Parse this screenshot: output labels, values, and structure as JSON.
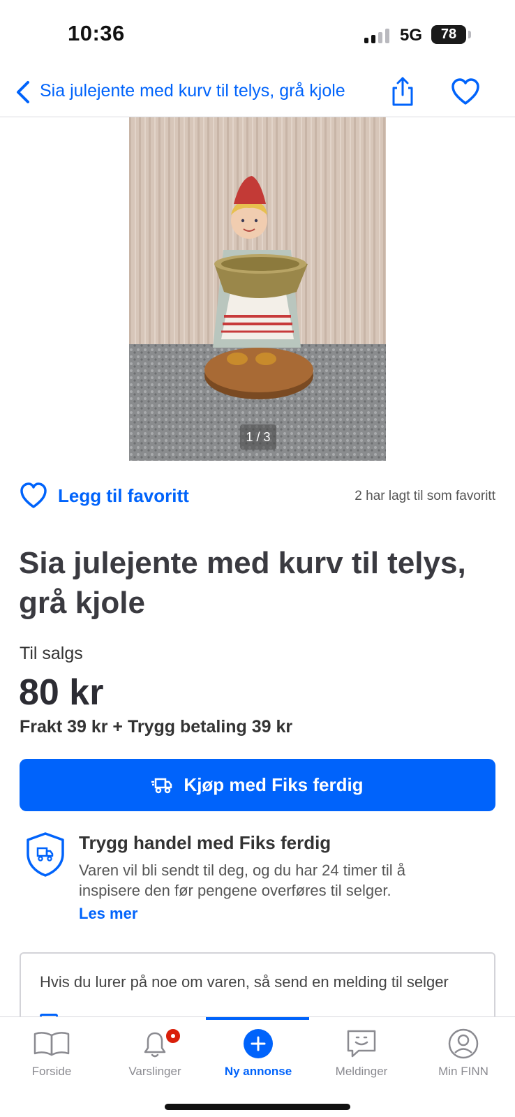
{
  "status_bar": {
    "time": "10:36",
    "network": "5G",
    "battery": "78"
  },
  "nav": {
    "title": "Sia julejente med kurv til telys, grå kjole",
    "back_icon": "chevron-left-icon",
    "share_icon": "share-icon",
    "favorite_icon": "heart-outline-icon"
  },
  "gallery": {
    "counter": "1 / 3",
    "current": 1,
    "total": 3,
    "image_description": "figurine-girl-with-basket"
  },
  "favorite": {
    "label": "Legg til favoritt",
    "count_text": "2 har lagt til som favoritt"
  },
  "item": {
    "title": "Sia julejente med kurv til telys, grå kjole",
    "status": "Til salgs",
    "price": "80 kr",
    "shipping": "Frakt 39 kr + Trygg betaling 39 kr"
  },
  "buy_button": {
    "label": "Kjøp med Fiks ferdig",
    "icon": "truck-icon"
  },
  "safe_trade": {
    "title": "Trygg handel med Fiks ferdig",
    "description": "Varen vil bli sendt til deg, og du har 24 timer til å inspisere den før pengene overføres til selger.",
    "link": "Les mer",
    "icon": "shield-truck-icon"
  },
  "contact": {
    "text": "Hvis du lurer på noe om varen, så send en melding til selger"
  },
  "tabs": [
    {
      "label": "Forside",
      "icon": "book-icon",
      "active": false
    },
    {
      "label": "Varslinger",
      "icon": "bell-icon",
      "active": false,
      "badge": true
    },
    {
      "label": "Ny annonse",
      "icon": "plus-circle-icon",
      "active": true
    },
    {
      "label": "Meldinger",
      "icon": "chat-icon",
      "active": false
    },
    {
      "label": "Min FINN",
      "icon": "user-circle-icon",
      "active": false
    }
  ],
  "colors": {
    "accent": "#0063fb",
    "badge": "#d91f0a",
    "text": "#2c2c33"
  }
}
